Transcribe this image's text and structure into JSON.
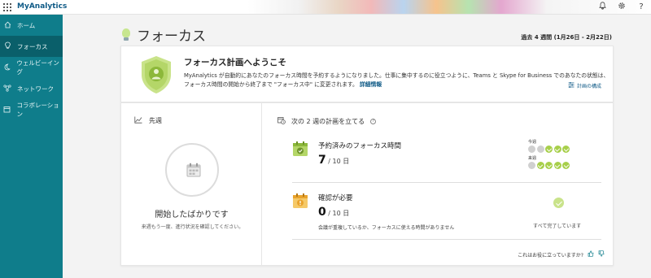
{
  "app": {
    "title": "MyAnalytics"
  },
  "topbar": {
    "icons": [
      "bell-icon",
      "gear-icon",
      "help-icon"
    ],
    "help_label": "?"
  },
  "sidebar": {
    "items": [
      {
        "label": "ホーム",
        "icon": "home-icon",
        "active": false
      },
      {
        "label": "フォーカス",
        "icon": "lightbulb-icon",
        "active": true
      },
      {
        "label": "ウェルビーイング",
        "icon": "moon-icon",
        "active": false
      },
      {
        "label": "ネットワーク",
        "icon": "network-icon",
        "active": false
      },
      {
        "label": "コラボレーション",
        "icon": "calendar-icon",
        "active": false
      }
    ]
  },
  "header": {
    "title": "フォーカス",
    "date_range": "過去 4 週間 (1月26日 - 2月22日)"
  },
  "welcome": {
    "title": "フォーカス計画へようこそ",
    "text": "MyAnalytics が自動的にあなたのフォーカス時間を予約するようになりました。仕事に集中するのに役立つように、Teams と Skype for Business でのあなたの状態は、フォーカス時間の開始から終了まで \"フォーカス中\" に変更されます。",
    "link": "詳細情報",
    "config_link": "計画の構成"
  },
  "last_week": {
    "heading": "先週",
    "status": "開始したばかりです",
    "note": "来週もう一度、進行状況を確認してください。"
  },
  "plan": {
    "heading": "次の 2 週の計画を立てる",
    "reserved": {
      "title": "予約済みのフォーカス時間",
      "count": "7",
      "denominator": " / 10 日",
      "this_week_label": "今週",
      "next_week_label": "来週",
      "this_week_done": 3,
      "next_week_done": 4,
      "total_days": 5
    },
    "needs_check": {
      "title": "確認が必要",
      "count": "0",
      "denominator": " / 10 日",
      "note": "会議が重複しているか、フォーカスに使える時間がありません",
      "done_label": "すべて完了しています"
    }
  },
  "feedback": {
    "question": "これはお役に立っていますか?"
  },
  "colors": {
    "sidebar": "#0f7d8b",
    "sidebar_active": "#0a5f6a",
    "accent_green": "#a7cf4a",
    "link": "#0f5a86"
  }
}
